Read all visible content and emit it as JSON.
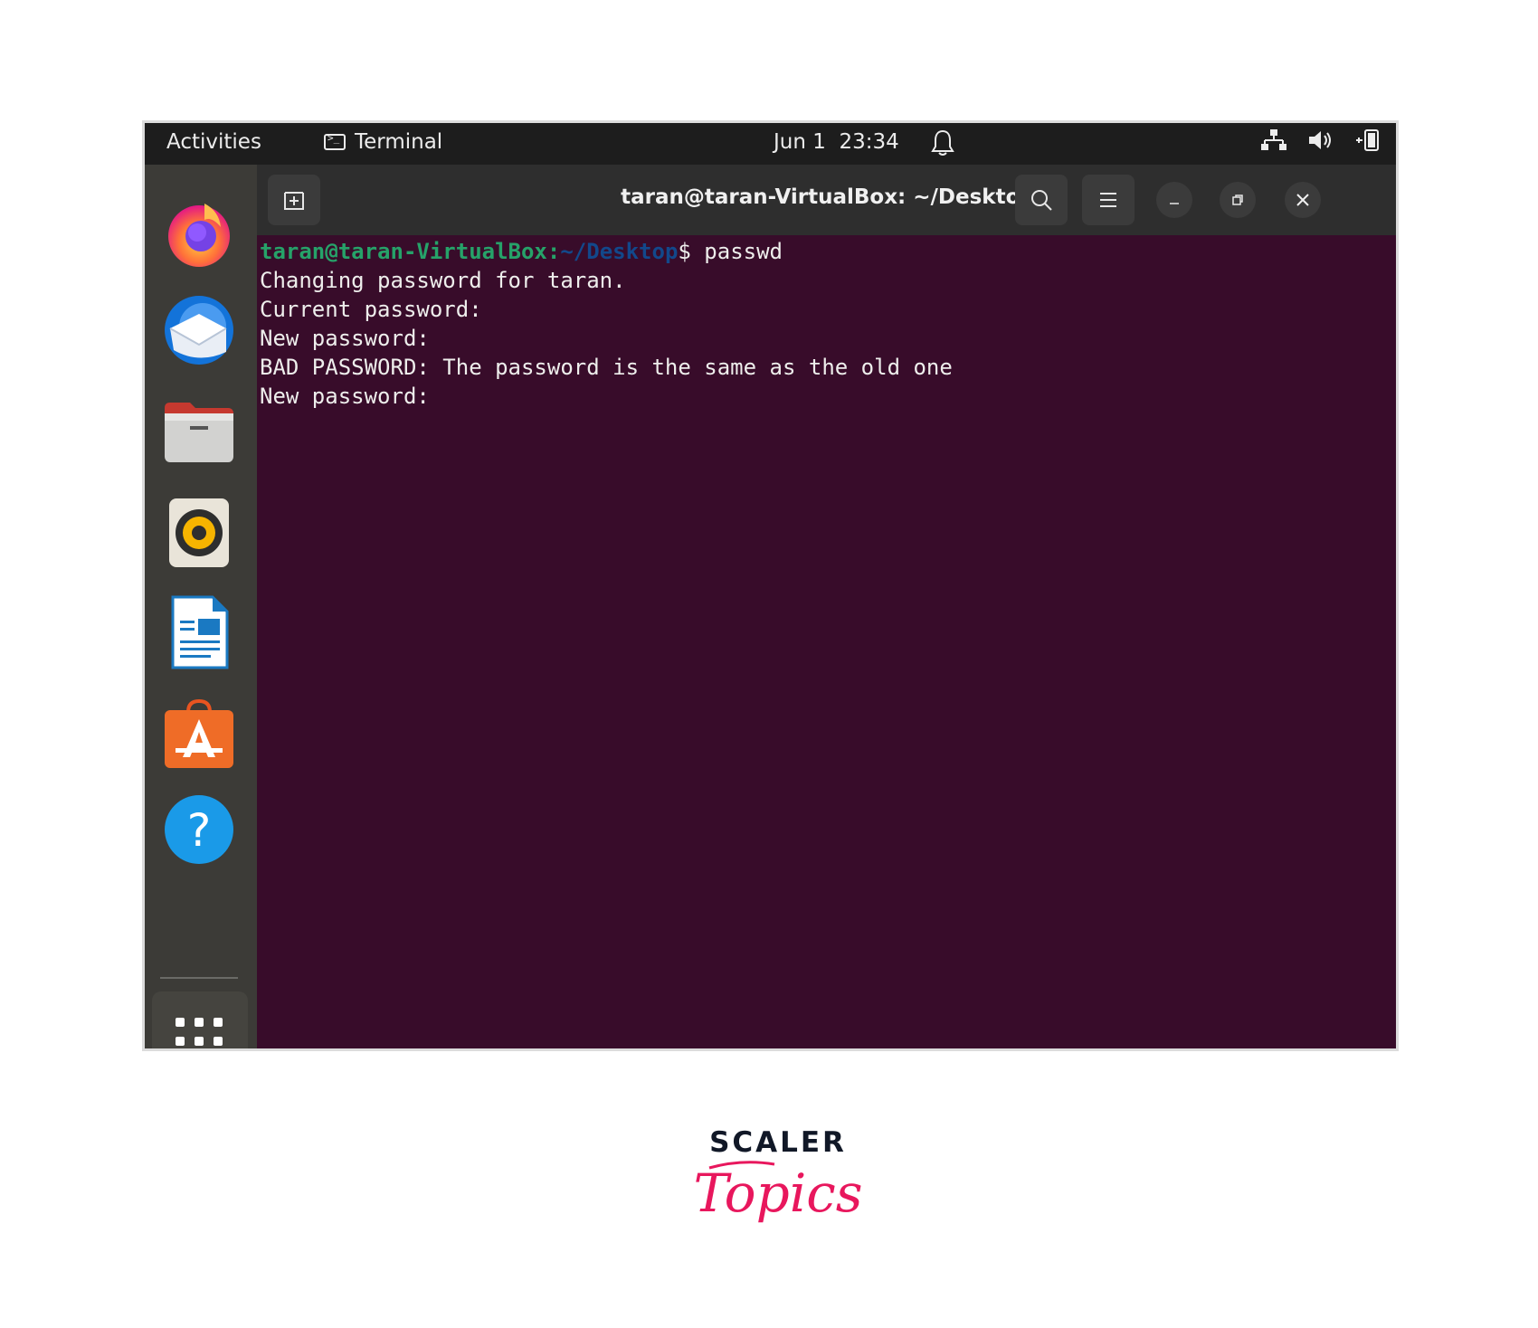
{
  "topbar": {
    "activities": "Activities",
    "app_name": "Terminal",
    "date": "Jun 1",
    "time": "23:34"
  },
  "dock": {
    "apps": [
      "firefox-icon",
      "thunderbird-icon",
      "files-icon",
      "rhythmbox-icon",
      "libreoffice-writer-icon",
      "software-center-icon",
      "help-icon",
      "show-apps-icon"
    ]
  },
  "terminal": {
    "title": "taran@taran-VirtualBox: ~/Desktop",
    "prompt_user": "taran@taran-VirtualBox",
    "prompt_sep": ":",
    "prompt_path": "~/Desktop",
    "prompt_symbol": "$ ",
    "command": "passwd",
    "lines": [
      "Changing password for taran.",
      "Current password:",
      "New password:",
      "BAD PASSWORD: The password is the same as the old one",
      "New password:"
    ]
  },
  "colors": {
    "terminal_bg": "#380c2a",
    "prompt_user": "#26a269",
    "prompt_path": "#12488b",
    "accent_logo": "#e8175d"
  },
  "logo": {
    "brand": "SCALER",
    "sub": "Topics"
  }
}
